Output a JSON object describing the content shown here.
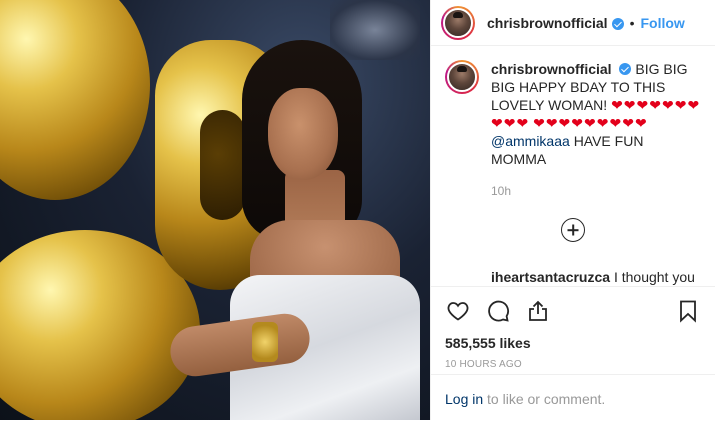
{
  "post": {
    "username": "chrisbrownofficial",
    "follow_label": "Follow",
    "dot": "•"
  },
  "caption": {
    "username": "chrisbrownofficial",
    "text_before": "BIG BIG BIG HAPPY BDAY TO THIS LOVELY WOMAN!",
    "hearts_line1": "❤❤❤❤❤❤❤❤❤❤",
    "hearts_line2": "❤❤❤❤❤❤❤❤❤",
    "mention": "@ammikaaa",
    "text_after": "HAVE FUN MOMMA",
    "time": "10h"
  },
  "comment": {
    "username": "iheartsantacruzca",
    "text": "I thought you were holding a sousaphone and got"
  },
  "stats": {
    "likes": "585,555 likes",
    "posted": "10 HOURS AGO"
  },
  "login": {
    "link": "Log in",
    "rest": "to like or comment."
  },
  "icons": {
    "like": "heart-icon",
    "comment": "comment-icon",
    "share": "share-icon",
    "save": "bookmark-icon",
    "more": "plus-circle-icon"
  },
  "colors": {
    "accent": "#3897f0",
    "mention": "#003569",
    "heart": "#e3001b"
  }
}
